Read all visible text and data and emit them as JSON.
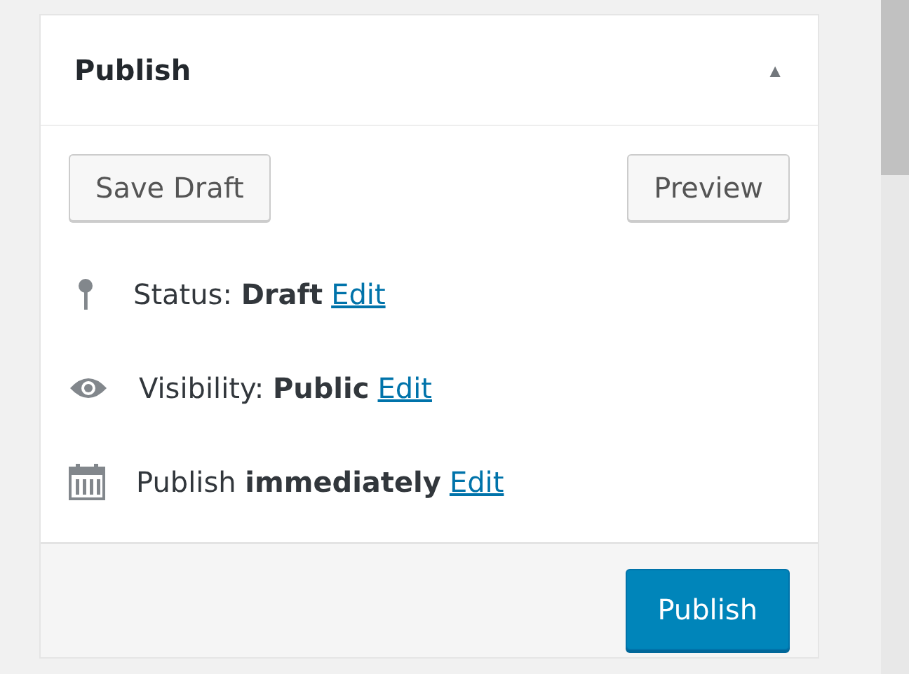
{
  "panel": {
    "title": "Publish",
    "toggle": "▲"
  },
  "buttons": [
    {
      "label": "Save Draft"
    },
    {
      "label": "Preview"
    }
  ],
  "rows": [
    {
      "kind": "status",
      "text": "Status: **Draft**",
      "link": "Edit"
    },
    {
      "kind": "visibility",
      "text": "Visibility: **Public**",
      "link": "Edit"
    },
    {
      "kind": "schedule",
      "text": "Publish **immediately**",
      "link": "Edit"
    }
  ],
  "publish_button": {
    "label": "Publish"
  }
}
